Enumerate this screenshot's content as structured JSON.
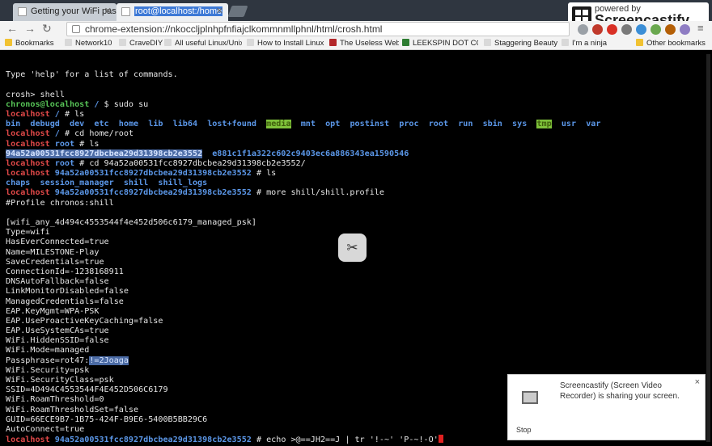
{
  "browser": {
    "tabs": [
      {
        "title": "Getting your WiFi passw"
      },
      {
        "title": "root@localhost:/home"
      }
    ],
    "url": "chrome-extension://nkoccljplnhpfnfiajclkommnmllphnl/html/crosh.html",
    "bookmarks": [
      {
        "label": "Bookmarks",
        "color": "#f1c232"
      },
      {
        "label": "Network10",
        "color": "#d9d9d9"
      },
      {
        "label": "CraveDIY",
        "color": "#d9d9d9"
      },
      {
        "label": "All useful Linux/Unix",
        "color": "#d9d9d9"
      },
      {
        "label": "How to Install Linux",
        "color": "#d9d9d9"
      },
      {
        "label": "The Useless Web",
        "color": "#b3272a"
      },
      {
        "label": "LEEKSPIN DOT COM",
        "color": "#2e7d32"
      },
      {
        "label": "Staggering Beauty",
        "color": "#d9d9d9"
      },
      {
        "label": "I'm a ninja",
        "color": "#d9d9d9"
      },
      {
        "label": "Other bookmarks",
        "color": "#f1c232"
      }
    ]
  },
  "screencastify": {
    "powered_by": "powered by",
    "name": "Screencastify Lite"
  },
  "terminal": {
    "lines": [
      [],
      [
        [
          "Type 'help' for a list of commands.",
          ""
        ]
      ],
      [],
      [
        [
          "crosh> shell",
          ""
        ]
      ],
      [
        [
          "chronos@localhost",
          "user"
        ],
        [
          " / ",
          "path"
        ],
        [
          "$ sudo su",
          ""
        ]
      ],
      [
        [
          "localhost",
          "host"
        ],
        [
          " / ",
          "path"
        ],
        [
          "# ls",
          ""
        ]
      ],
      [
        [
          "bin",
          "dir"
        ],
        [
          "  ",
          ""
        ],
        [
          "debugd",
          "dir"
        ],
        [
          "  ",
          ""
        ],
        [
          "dev",
          "dir"
        ],
        [
          "  ",
          ""
        ],
        [
          "etc",
          "dir"
        ],
        [
          "  ",
          ""
        ],
        [
          "home",
          "dir"
        ],
        [
          "  ",
          ""
        ],
        [
          "lib",
          "dir"
        ],
        [
          "  ",
          ""
        ],
        [
          "lib64",
          "dir"
        ],
        [
          "  ",
          ""
        ],
        [
          "lost+found",
          "dir"
        ],
        [
          "  ",
          ""
        ],
        [
          "media",
          "dirhl"
        ],
        [
          "  ",
          ""
        ],
        [
          "mnt",
          "dir"
        ],
        [
          "  ",
          ""
        ],
        [
          "opt",
          "dir"
        ],
        [
          "  ",
          ""
        ],
        [
          "postinst",
          "dir"
        ],
        [
          "  ",
          ""
        ],
        [
          "proc",
          "dir"
        ],
        [
          "  ",
          ""
        ],
        [
          "root",
          "dir"
        ],
        [
          "  ",
          ""
        ],
        [
          "run",
          "dir"
        ],
        [
          "  ",
          ""
        ],
        [
          "sbin",
          "dir"
        ],
        [
          "  ",
          ""
        ],
        [
          "sys",
          "dir"
        ],
        [
          "  ",
          ""
        ],
        [
          "tmp",
          "dirhl"
        ],
        [
          "  ",
          ""
        ],
        [
          "usr",
          "dir"
        ],
        [
          "  ",
          ""
        ],
        [
          "var",
          "dir"
        ]
      ],
      [
        [
          "localhost",
          "host"
        ],
        [
          " / ",
          "path"
        ],
        [
          "# cd home/root",
          ""
        ]
      ],
      [
        [
          "localhost",
          "host"
        ],
        [
          " root ",
          "path"
        ],
        [
          "# ls",
          ""
        ]
      ],
      [
        [
          "94a52a00531fcc8927dbcbea29d31398cb2e3552",
          "sel dir"
        ],
        [
          "  ",
          ""
        ],
        [
          "e881c1f1a322c602c9403ec6a886343ea1590546",
          "dir"
        ]
      ],
      [
        [
          "localhost",
          "host"
        ],
        [
          " root ",
          "path"
        ],
        [
          "# cd 94a52a00531fcc8927dbcbea29d31398cb2e3552/",
          ""
        ]
      ],
      [
        [
          "localhost",
          "host"
        ],
        [
          " 94a52a00531fcc8927dbcbea29d31398cb2e3552 ",
          "path"
        ],
        [
          "# ls",
          ""
        ]
      ],
      [
        [
          "chaps",
          "dir"
        ],
        [
          "  ",
          ""
        ],
        [
          "session_manager",
          "dir"
        ],
        [
          "  ",
          ""
        ],
        [
          "shill",
          "dir"
        ],
        [
          "  ",
          ""
        ],
        [
          "shill_logs",
          "dir"
        ]
      ],
      [
        [
          "localhost",
          "host"
        ],
        [
          " 94a52a00531fcc8927dbcbea29d31398cb2e3552 ",
          "path"
        ],
        [
          "# more shill/shill.profile",
          ""
        ]
      ],
      [
        [
          "#Profile chronos:shill",
          ""
        ]
      ],
      [],
      [
        [
          "[wifi_any_4d494c4553544f4e452d506c6179_managed_psk]",
          ""
        ]
      ],
      [
        [
          "Type=wifi",
          ""
        ]
      ],
      [
        [
          "HasEverConnected=true",
          ""
        ]
      ],
      [
        [
          "Name=MILESTONE-Play",
          ""
        ]
      ],
      [
        [
          "SaveCredentials=true",
          ""
        ]
      ],
      [
        [
          "ConnectionId=-1238168911",
          ""
        ]
      ],
      [
        [
          "DNSAutoFallback=false",
          ""
        ]
      ],
      [
        [
          "LinkMonitorDisabled=false",
          ""
        ]
      ],
      [
        [
          "ManagedCredentials=false",
          ""
        ]
      ],
      [
        [
          "EAP.KeyMgmt=WPA-PSK",
          ""
        ]
      ],
      [
        [
          "EAP.UseProactiveKeyCaching=false",
          ""
        ]
      ],
      [
        [
          "EAP.UseSystemCAs=true",
          ""
        ]
      ],
      [
        [
          "WiFi.HiddenSSID=false",
          ""
        ]
      ],
      [
        [
          "WiFi.Mode=managed",
          ""
        ]
      ],
      [
        [
          "Passphrase=rot47:",
          ""
        ],
        [
          "!=2Joaga",
          "sel"
        ]
      ],
      [
        [
          "WiFi.Security=psk",
          ""
        ]
      ],
      [
        [
          "WiFi.SecurityClass=psk",
          ""
        ]
      ],
      [
        [
          "SSID=4D494C4553544F4E452D506C6179",
          ""
        ]
      ],
      [
        [
          "WiFi.RoamThreshold=0",
          ""
        ]
      ],
      [
        [
          "WiFi.RoamThresholdSet=false",
          ""
        ]
      ],
      [
        [
          "GUID=66ECE9B7-1B75-424F-B9E6-5400B5BB29C6",
          ""
        ]
      ],
      [
        [
          "AutoConnect=true",
          ""
        ]
      ],
      [
        [
          "localhost",
          "host"
        ],
        [
          " 94a52a00531fcc8927dbcbea29d31398cb2e3552 ",
          "path"
        ],
        [
          "# echo >@==JH2==J | tr '!-~' 'P-~!-O'",
          ""
        ]
      ]
    ]
  },
  "notification": {
    "text": "Screencastify (Screen Video Recorder) is sharing your screen.",
    "close": "×",
    "stop_label": "Stop"
  }
}
